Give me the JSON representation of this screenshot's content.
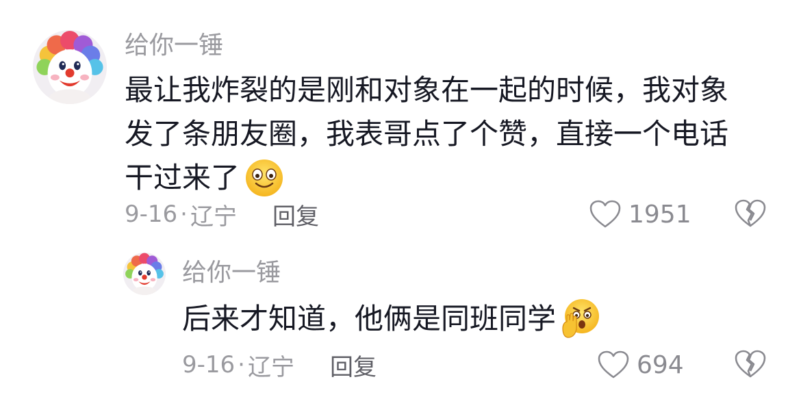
{
  "comments": [
    {
      "username": "给你一锤",
      "text": "最让我炸裂的是刚和对象在一起的时候，我对象发了条朋友圈，我表哥点了个赞，直接一个电话干过来了",
      "emoji": "smiling-face-emoji",
      "date": "9-16",
      "separator": "·",
      "location": "辽宁",
      "reply_label": "回复",
      "likes": "1951"
    },
    {
      "username": "给你一锤",
      "text": "后来才知道，他俩是同班同学",
      "emoji": "shocked-face-emoji",
      "date": "9-16",
      "separator": "·",
      "location": "辽宁",
      "reply_label": "回复",
      "likes": "694"
    }
  ],
  "icons": {
    "like": "heart-outline-icon",
    "dislike": "broken-heart-outline-icon",
    "avatar": "clown-avatar"
  },
  "colors": {
    "text_primary": "#161823",
    "text_secondary": "#9a9a9f",
    "icon": "#8a8a90"
  }
}
